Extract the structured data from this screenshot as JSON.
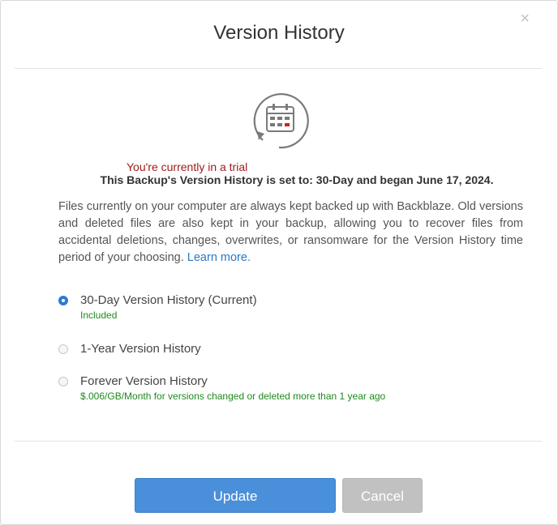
{
  "dialog": {
    "title": "Version History",
    "close_glyph": "×",
    "icon": "calendar-history-icon",
    "trial_note": "You're currently in a trial",
    "setting_line": "This Backup's Version History is set to: 30-Day and began June 17, 2024.",
    "description": "Files currently on your computer are always kept backed up with Backblaze. Old versions and deleted files are also kept in your backup, allowing you to recover files from accidental deletions, changes, overwrites, or ransomware for the Version History time period of your choosing.",
    "learn_more": "Learn more.",
    "options": [
      {
        "label": "30-Day Version History (Current)",
        "sublabel": "Included",
        "selected": true
      },
      {
        "label": "1-Year Version History",
        "sublabel": "",
        "selected": false
      },
      {
        "label": "Forever Version History",
        "sublabel": "$.006/GB/Month for versions changed or deleted more than 1 year ago",
        "selected": false
      }
    ],
    "update_label": "Update",
    "cancel_label": "Cancel"
  },
  "colors": {
    "accent": "#4a8fd9",
    "trial_text": "#a11a1a",
    "included_text": "#1e8a1e",
    "link": "#2b78c5",
    "cancel_bg": "#c1c1c1"
  }
}
